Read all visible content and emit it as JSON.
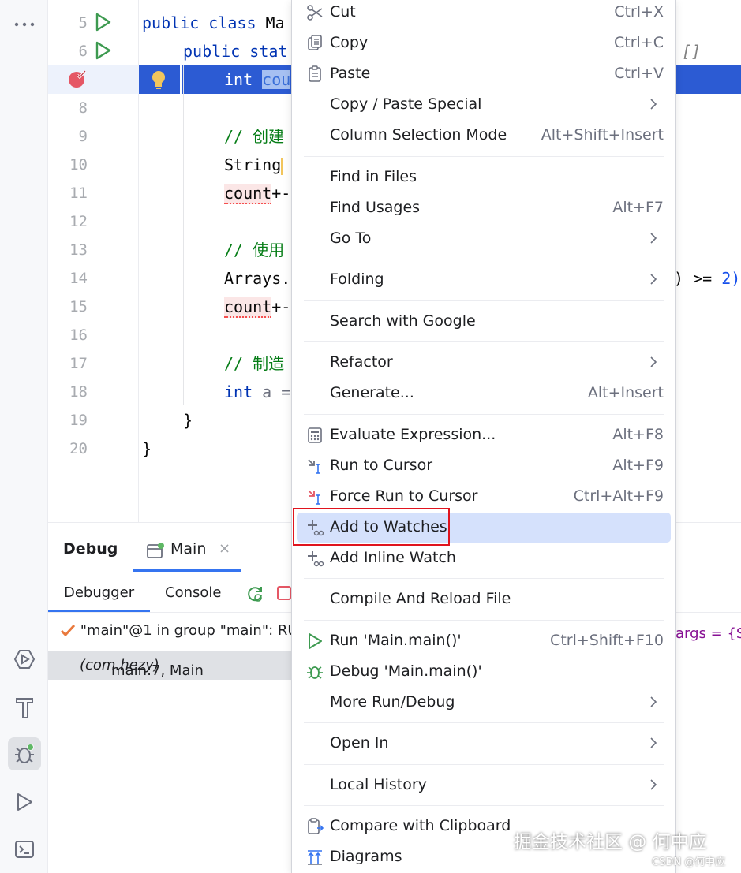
{
  "toolstrip": {
    "more_icon": "ellipsis-icon",
    "tools": [
      {
        "name": "services-icon"
      },
      {
        "name": "build-icon"
      },
      {
        "name": "debug-icon"
      },
      {
        "name": "run-icon"
      },
      {
        "name": "terminal-icon"
      }
    ]
  },
  "editor": {
    "line_numbers": [
      "5",
      "6",
      "",
      "8",
      "9",
      "10",
      "11",
      "12",
      "13",
      "14",
      "15",
      "16",
      "17",
      "18",
      "19",
      "20"
    ],
    "lines": {
      "l5a": "public class ",
      "l5b": "Ma",
      "l6a": "public ",
      "l6b": "stat",
      "l7a": "int ",
      "l7b": "cou",
      "l9": "// 创建",
      "l10": "String",
      "l11a": "count",
      "l11b": "+-",
      "l13": "// 使用",
      "l14a": "Arrays.",
      "l14b": ") >= ",
      "l14c": "2)",
      "l15a": "count",
      "l15b": "+-",
      "l17": "// 制造",
      "l18a": "int ",
      "l18b": "a =",
      "l19": "}",
      "l20": "}",
      "l6_tail": "[]"
    }
  },
  "debug": {
    "title": "Debug",
    "run_tab": "Main",
    "close": "×",
    "subtabs": [
      "Debugger",
      "Console"
    ],
    "thread": "\"main\"@1 in group \"main\": RU",
    "frame_method": "main:7, Main ",
    "frame_pkg": "(com.hezy)",
    "vars": "args = {St"
  },
  "menu": {
    "items": [
      {
        "label": "Cut",
        "shortcut": "Ctrl+X"
      },
      {
        "label": "Copy",
        "shortcut": "Ctrl+C"
      },
      {
        "label": "Paste",
        "shortcut": "Ctrl+V"
      },
      {
        "label": "Copy / Paste Special",
        "shortcut": ""
      },
      {
        "label": "Column Selection Mode",
        "shortcut": "Alt+Shift+Insert"
      },
      {
        "label": "Find in Files",
        "shortcut": ""
      },
      {
        "label": "Find Usages",
        "shortcut": "Alt+F7"
      },
      {
        "label": "Go To",
        "shortcut": ""
      },
      {
        "label": "Folding",
        "shortcut": ""
      },
      {
        "label": "Search with Google",
        "shortcut": ""
      },
      {
        "label": "Refactor",
        "shortcut": ""
      },
      {
        "label": "Generate...",
        "shortcut": "Alt+Insert"
      },
      {
        "label": "Evaluate Expression...",
        "shortcut": "Alt+F8"
      },
      {
        "label": "Run to Cursor",
        "shortcut": "Alt+F9"
      },
      {
        "label": "Force Run to Cursor",
        "shortcut": "Ctrl+Alt+F9"
      },
      {
        "label": "Add to Watches",
        "shortcut": ""
      },
      {
        "label": "Add Inline Watch",
        "shortcut": ""
      },
      {
        "label": "Compile And Reload File",
        "shortcut": ""
      },
      {
        "label": "Run 'Main.main()'",
        "shortcut": "Ctrl+Shift+F10"
      },
      {
        "label": "Debug 'Main.main()'",
        "shortcut": ""
      },
      {
        "label": "More Run/Debug",
        "shortcut": ""
      },
      {
        "label": "Open In",
        "shortcut": ""
      },
      {
        "label": "Local History",
        "shortcut": ""
      },
      {
        "label": "Compare with Clipboard",
        "shortcut": ""
      },
      {
        "label": "Diagrams",
        "shortcut": ""
      }
    ]
  },
  "watermark": "掘金技术社区 @ 何中应",
  "watermark_small": "CSDN @何中应",
  "colors": {
    "accent": "#3574f0",
    "selection_row": "#2c5bd3",
    "hover": "#d5e1fc",
    "highlight_box": "#e0141e"
  }
}
